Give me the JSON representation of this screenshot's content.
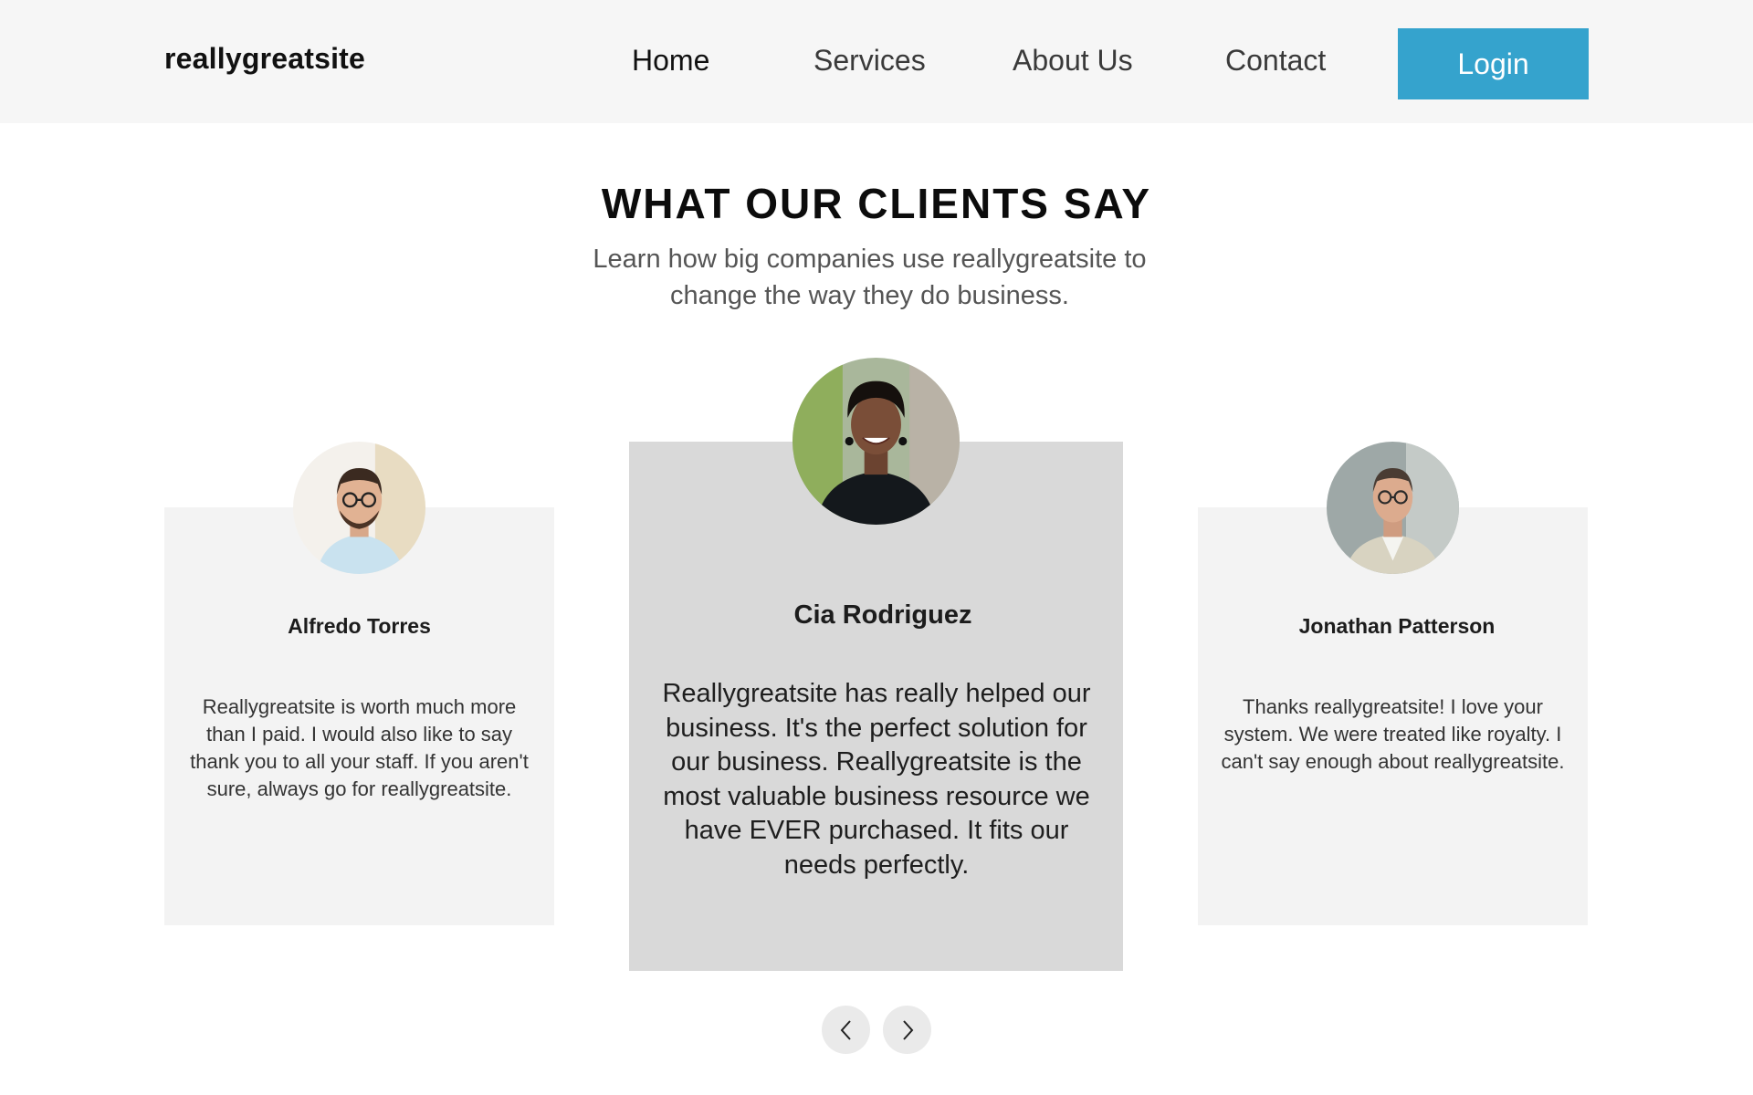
{
  "header": {
    "logo": "reallygreatsite",
    "nav": {
      "home": "Home",
      "services": "Services",
      "about": "About Us",
      "contact": "Contact"
    },
    "login_label": "Login",
    "accent_color": "#35a3cd"
  },
  "section": {
    "title": "WHAT OUR CLIENTS SAY",
    "subtitle": "Learn how big companies use reallygreatsite to change the way they do business."
  },
  "testimonials": [
    {
      "name": "Alfredo Torres",
      "quote": "Reallygreatsite is worth much more than I paid. I would also like to say thank you to all your staff. If you aren't sure, always go for reallygreatsite.",
      "avatar_icon": "man-with-glasses-photo"
    },
    {
      "name": "Cia Rodriguez",
      "quote": "Reallygreatsite has really helped our business. It's the perfect solution for our business. Reallygreatsite is the most valuable business resource we have EVER purchased. It fits our needs perfectly.",
      "avatar_icon": "smiling-woman-photo"
    },
    {
      "name": "Jonathan Patterson",
      "quote": "Thanks reallygreatsite! I love your system. We were treated like royalty. I can't say enough about reallygreatsite.",
      "avatar_icon": "man-in-blazer-photo"
    }
  ],
  "carousel": {
    "prev_icon": "chevron-left-icon",
    "next_icon": "chevron-right-icon"
  }
}
